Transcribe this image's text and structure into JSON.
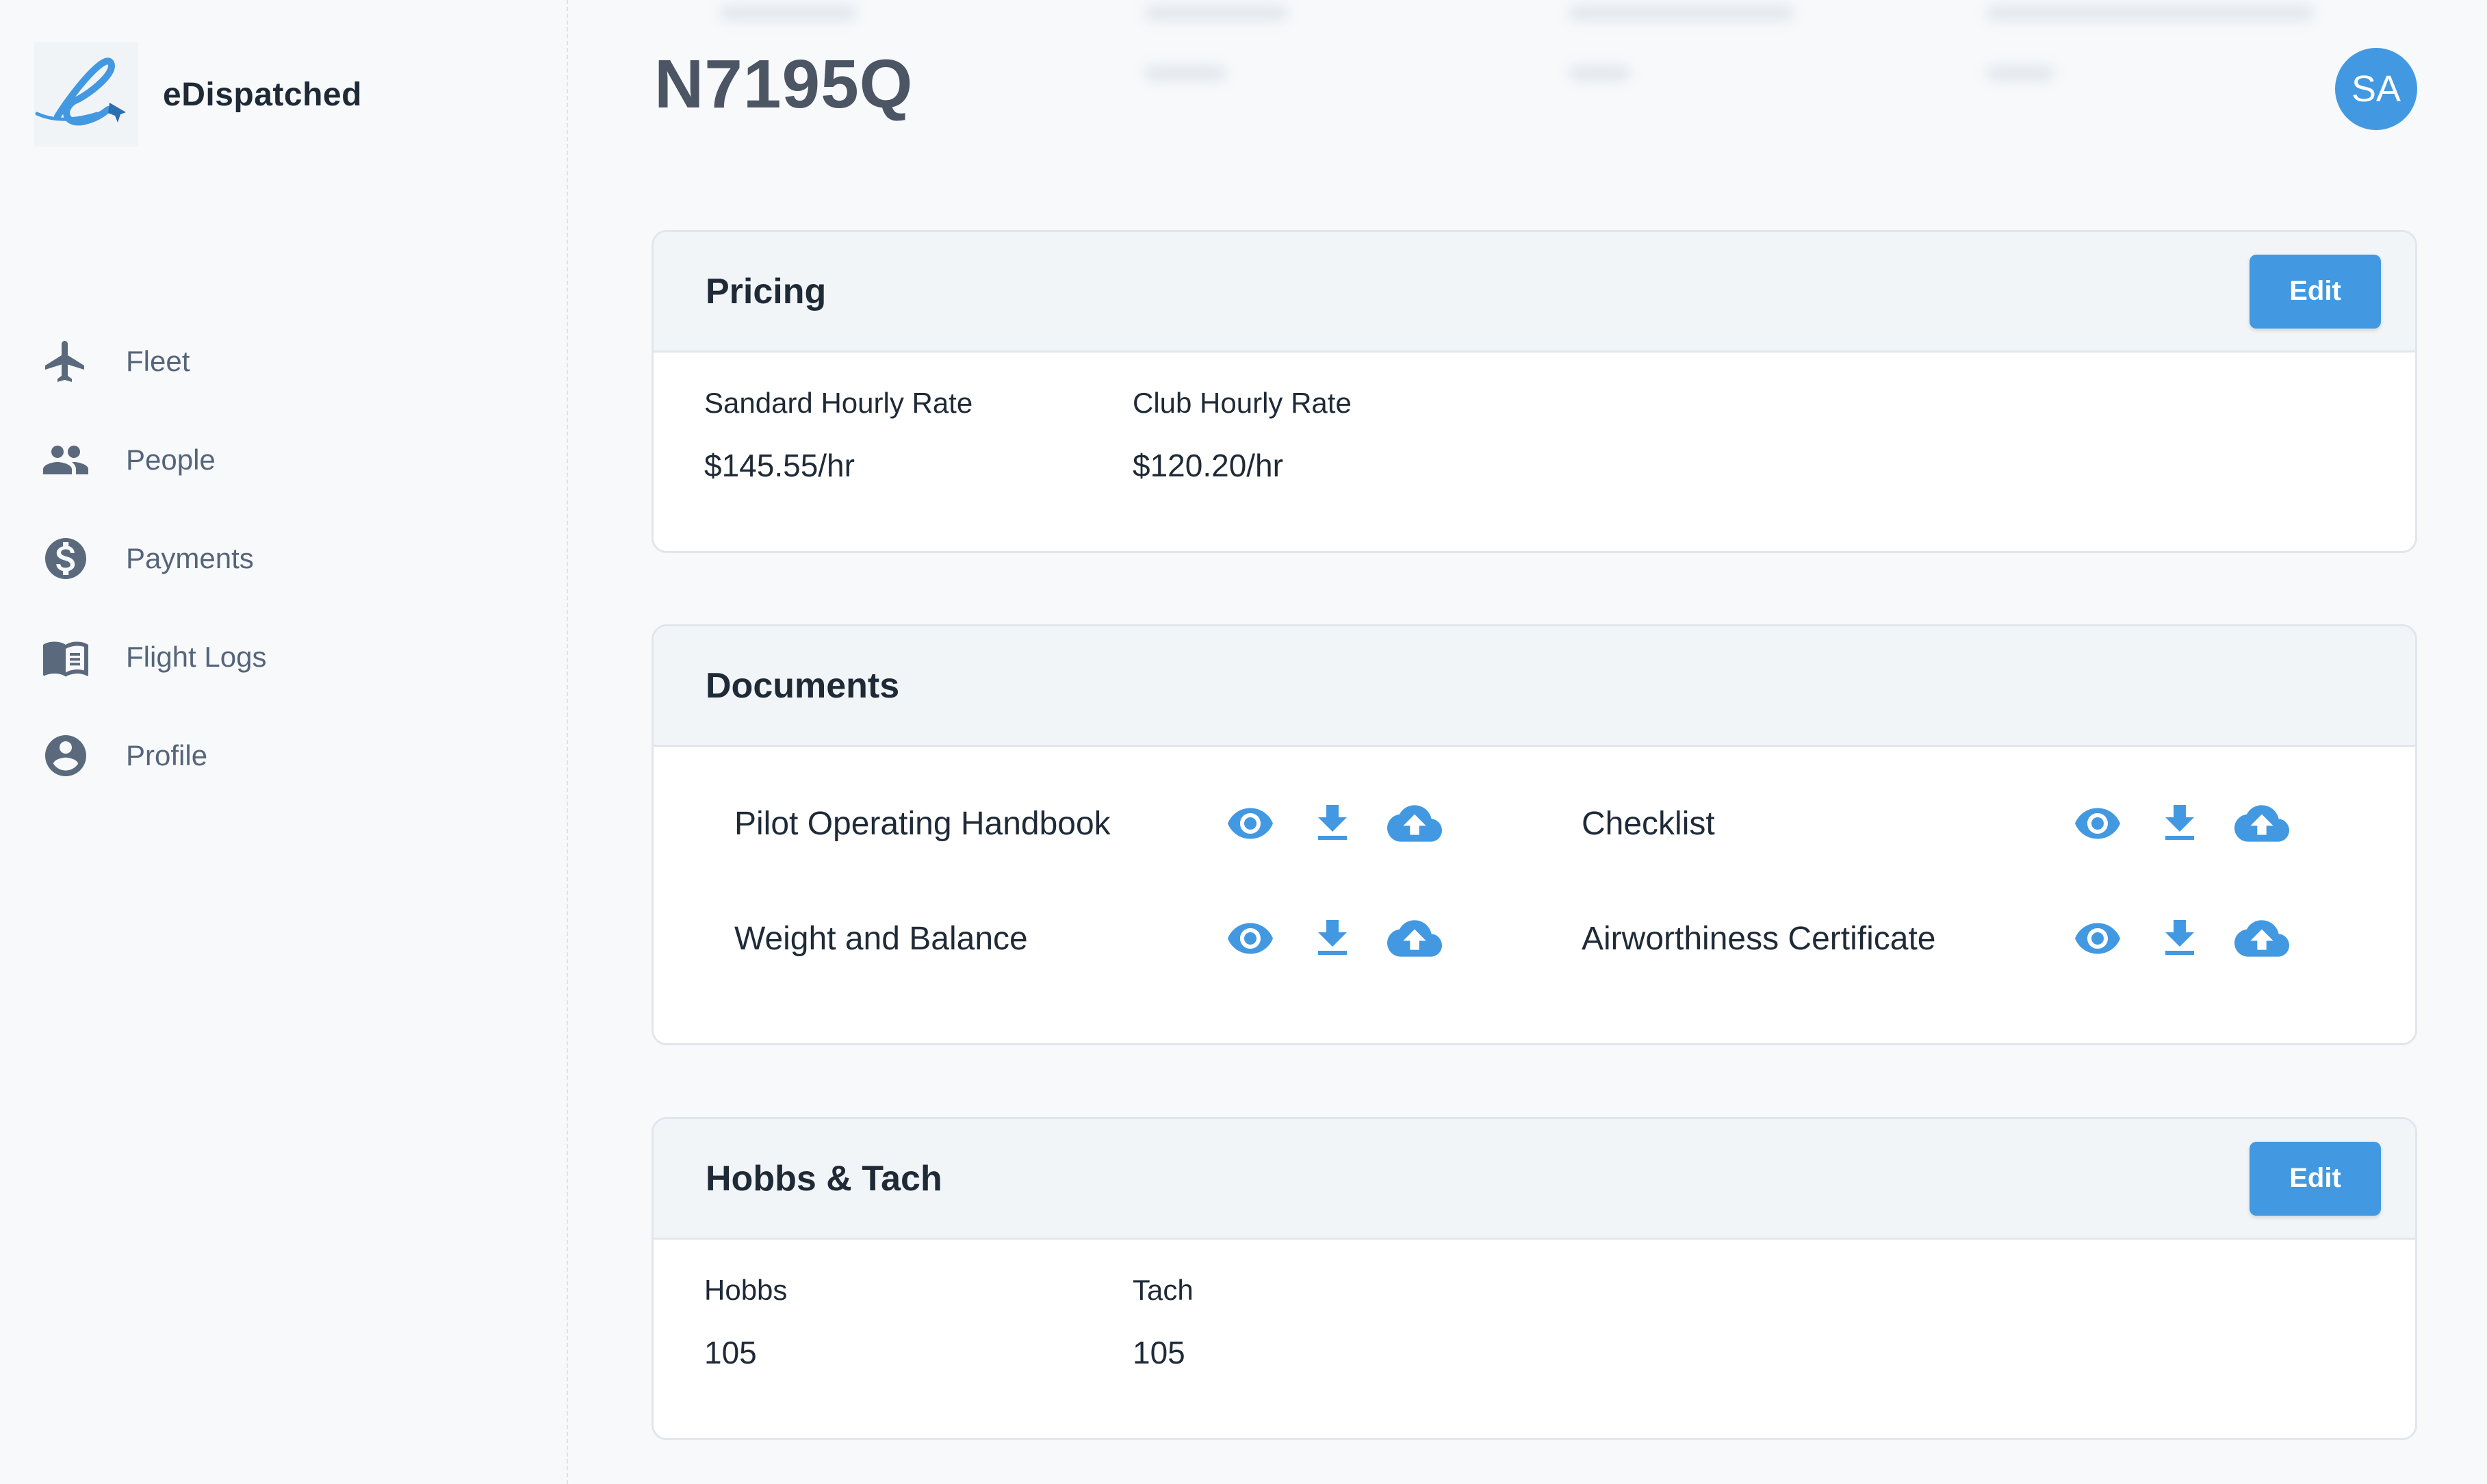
{
  "brand": {
    "name": "eDispatched",
    "logo_icon": "edispatched-logo"
  },
  "sidebar": {
    "items": [
      {
        "label": "Fleet",
        "icon": "airplane-icon"
      },
      {
        "label": "People",
        "icon": "people-icon"
      },
      {
        "label": "Payments",
        "icon": "dollar-circle-icon"
      },
      {
        "label": "Flight Logs",
        "icon": "book-icon"
      },
      {
        "label": "Profile",
        "icon": "user-circle-icon"
      }
    ]
  },
  "header": {
    "title": "N7195Q",
    "avatar_initials": "SA"
  },
  "pricing": {
    "title": "Pricing",
    "edit_label": "Edit",
    "standard_label": "Sandard Hourly Rate",
    "standard_value": "$145.55/hr",
    "club_label": "Club Hourly Rate",
    "club_value": "$120.20/hr"
  },
  "documents": {
    "title": "Documents",
    "items": [
      {
        "name": "Pilot Operating Handbook"
      },
      {
        "name": "Checklist"
      },
      {
        "name": "Weight and Balance"
      },
      {
        "name": "Airworthiness Certificate"
      }
    ],
    "action_icons": [
      "eye-icon",
      "download-icon",
      "cloud-upload-icon"
    ]
  },
  "hobbs_tach": {
    "title": "Hobbs & Tach",
    "edit_label": "Edit",
    "hobbs_label": "Hobbs",
    "hobbs_value": "105",
    "tach_label": "Tach",
    "tach_value": "105"
  },
  "colors": {
    "accent": "#4299e1",
    "sidebar_icon": "#5a6a7c",
    "title": "#4b5563",
    "card_header_bg": "#f2f5f8",
    "page_bg": "#f7f9fb"
  }
}
